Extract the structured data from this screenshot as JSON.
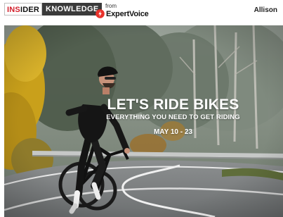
{
  "header": {
    "brand": {
      "insider_prefix": "INS",
      "insider_rest": "IDER",
      "knowledge": "KNOWLEDGE"
    },
    "from_label": "from",
    "partner_name": "ExpertVoice",
    "partner_icon": "expertvoice-logo-icon",
    "user_name": "Allison"
  },
  "hero": {
    "headline": "LET'S RIDE BIKES",
    "subheadline": "EVERYTHING YOU NEED TO GET RIDING",
    "dates": "MAY 10 - 23"
  },
  "colors": {
    "brand_red": "#d21f2b",
    "knowledge_bg": "#3a3a3a",
    "expertvoice_red": "#e8322b"
  }
}
